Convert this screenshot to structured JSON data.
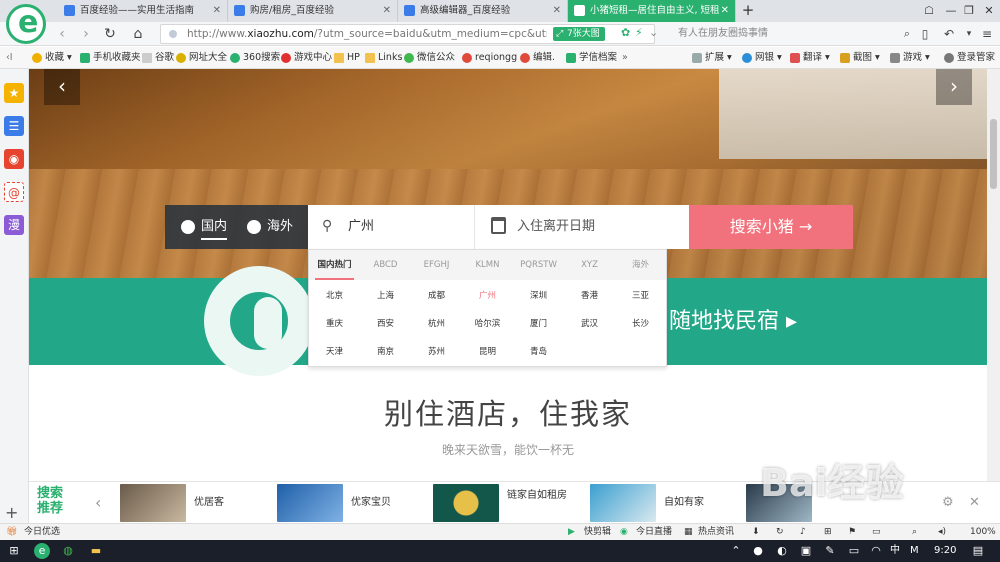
{
  "tabs": [
    {
      "label": "百度经验——实用生活指南",
      "active": false
    },
    {
      "label": "购房/租房_百度经验",
      "active": false
    },
    {
      "label": "高级编辑器_百度经验",
      "active": false
    },
    {
      "label": "小猪短租—居住自由主义, 短租",
      "active": true
    }
  ],
  "new_tab": "+",
  "address": {
    "url_prefix": "http://www.",
    "url_domain": "xiaozhu.com",
    "url_rest": "/?utm_source=baidu&utm_medium=cpc&utm_te",
    "bigimg_label": "7张大图",
    "search_placeholder": "有人在朋友圈捣事情"
  },
  "bookmarks": [
    "收藏",
    "手机收藏夹",
    "谷歌",
    "网址大全",
    "360搜索",
    "游戏中心",
    "HP",
    "Links",
    "微信公众",
    "reqiongg",
    "编辑.",
    "学信档案"
  ],
  "bookmarks_right": [
    "扩展",
    "网银",
    "翻译",
    "截图",
    "游戏",
    "登录管家"
  ],
  "hero": {
    "tabs": [
      {
        "label": "国内",
        "active": true
      },
      {
        "label": "海外",
        "active": false
      }
    ],
    "city_value": "广州",
    "date_placeholder": "入住离开日期",
    "search_button": "搜索小猪 →"
  },
  "dropdown": {
    "tabs": [
      "国内热门",
      "ABCD",
      "EFGHJ",
      "KLMN",
      "PQRSTW",
      "XYZ",
      "海外"
    ],
    "rows": [
      [
        "北京",
        "上海",
        "成都",
        "广州",
        "深圳",
        "香港",
        "三亚"
      ],
      [
        "重庆",
        "西安",
        "杭州",
        "哈尔滨",
        "厦门",
        "武汉",
        "长沙"
      ],
      [
        "天津",
        "南京",
        "苏州",
        "昆明",
        "青岛"
      ]
    ],
    "selected": "广州"
  },
  "promo_text": "随地找民宿 ▸",
  "slogan": "别住酒店，住我家",
  "sub_slogan": "晚来天欲雪，能饮一杯无",
  "rec": {
    "label": "搜索推荐",
    "items": [
      "优居客",
      "优家宝贝",
      "链家自如租房",
      "自如有家"
    ]
  },
  "status": {
    "left": "今日优选",
    "right": [
      "快剪辑",
      "今日直播",
      "热点资讯",
      "100%"
    ]
  },
  "taskbar": {
    "ime": "中",
    "ime2": "M",
    "time": "9:20"
  },
  "colors": {
    "accent_green": "#2ab06f",
    "brand_pink": "#f1727c",
    "band_green": "#22a888"
  }
}
